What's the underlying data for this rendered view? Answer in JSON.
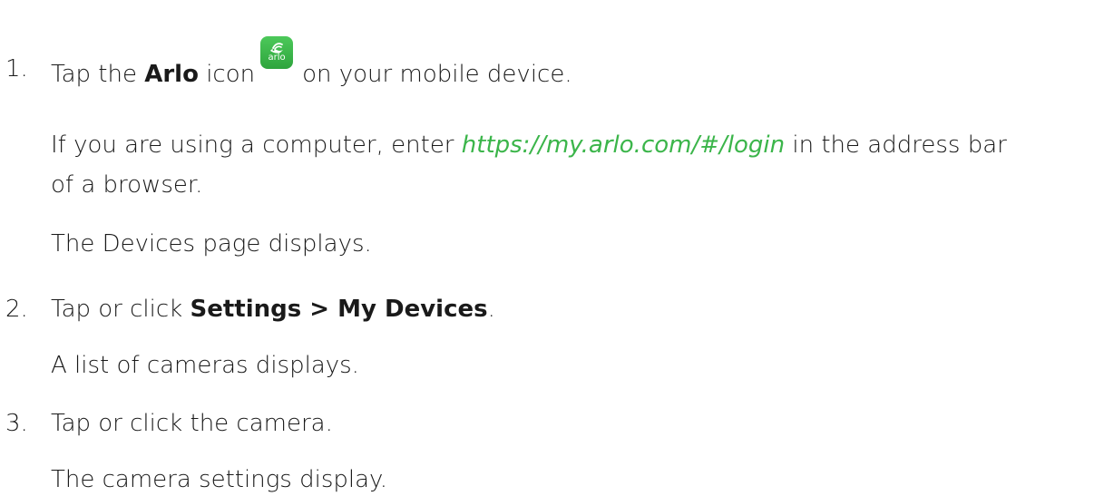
{
  "steps": [
    {
      "number": "1.",
      "text_before": "Tap the ",
      "bold": "Arlo",
      "text_mid": " icon",
      "text_after": "on your mobile device.",
      "note_prefix": "If you are using a computer, enter ",
      "note_link": "https://my.arlo.com/#/login",
      "note_suffix": " in the address bar",
      "note_line2": "of a browser.",
      "result": "The Devices page displays."
    },
    {
      "number": "2.",
      "text_before": "Tap or click ",
      "bold": "Settings > My Devices",
      "text_after": ".",
      "result": "A list of cameras displays."
    },
    {
      "number": "3.",
      "text": "Tap or click the camera.",
      "result": "The camera settings display."
    }
  ],
  "icon": {
    "name": "arlo-app-icon",
    "wordmark": "arlo",
    "color": "#3bb54a"
  },
  "colors": {
    "link": "#3bb54a",
    "text": "#1a1a1a"
  }
}
